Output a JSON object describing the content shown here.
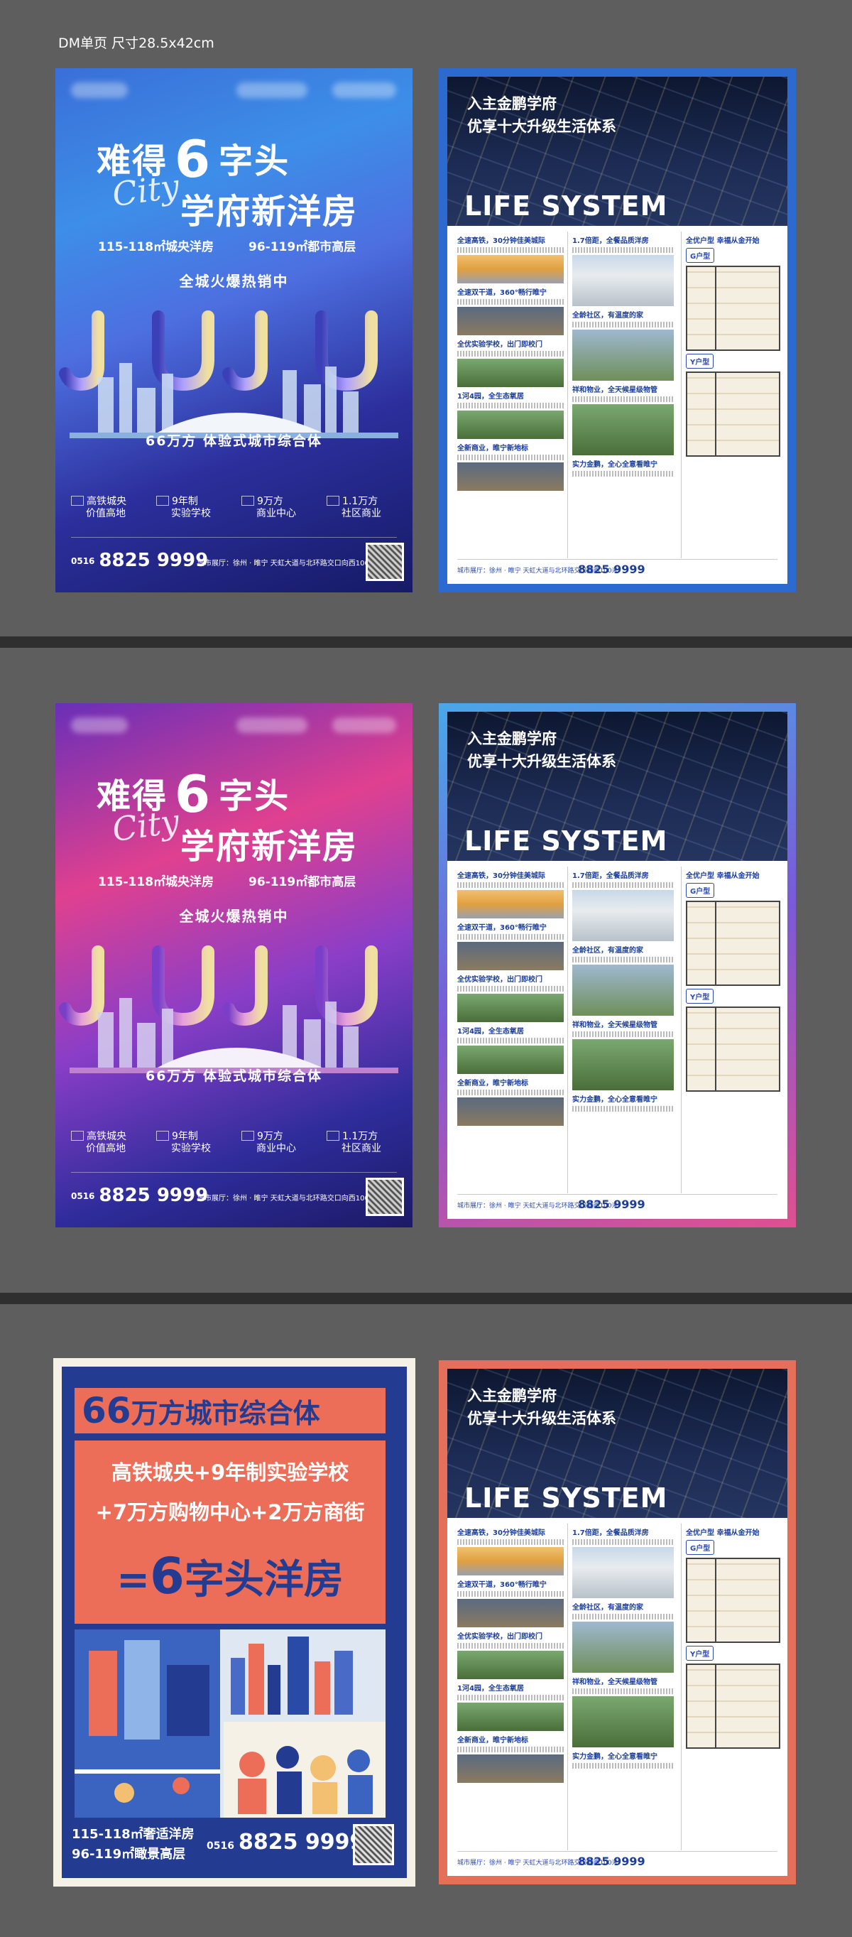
{
  "caption": "DM单页 尺寸28.5x42cm",
  "left_poster": {
    "line1_a": "难得",
    "line1_num": "6",
    "line1_b": "字头",
    "script_word": "City",
    "line2": "学府新洋房",
    "spec_left": "115-118㎡城央洋房",
    "spec_right": "96-119㎡都市高层",
    "hot": "全城火爆热销中",
    "letters": "JIUJIU",
    "slogan": "66万方  体验式城市综合体",
    "features": [
      {
        "l1": "高铁城央",
        "l2": "价值高地"
      },
      {
        "l1": "9年制",
        "l2": "实验学校"
      },
      {
        "l1": "9万方",
        "l2": "商业中心"
      },
      {
        "l1": "1.1万方",
        "l2": "社区商业"
      }
    ],
    "phone_area": "0516",
    "phone": "8825 9999",
    "address": "城市展厅：徐州 · 睢宁  天虹大道与北环路交口向西100米"
  },
  "right_poster": {
    "title1": "入主金鹏学府",
    "title2": "优享十大升级生活体系",
    "life": "LIFE SYSTEM",
    "col1": [
      "全速高铁，30分钟佳美城际",
      "全速双干道，360°畅行睢宁",
      "全优实验学校，出门即校门",
      "1河4园，全生态氧居",
      "全新商业，睢宁新地标"
    ],
    "col2": [
      "1.7倍距，全餐品质洋房",
      "全龄社区，有温度的家",
      "祥和物业，全天候星级物管",
      "实力金鹏，全心全意看睢宁"
    ],
    "col3_head": "全优户型 幸福从金开始",
    "plan_a": "G户型",
    "plan_b": "Y户型",
    "footer_addr": "城市展厅：徐州 · 睢宁 天虹大道与北环路交口向西100米",
    "footer_phone": "8825 9999"
  },
  "poster5": {
    "head_num": "66",
    "head": "万方城市综合体",
    "line1": "高铁城央+9年制实验学校",
    "line2": "+7万方购物中心+2万方商街",
    "eq_a": "=",
    "eq_num": "6",
    "eq_b": "字头洋房",
    "spec1": "115-118㎡奢适洋房",
    "spec2": "96-119㎡瞰景高层",
    "phone_area": "0516",
    "phone": "8825 9999"
  },
  "colors": {
    "blue": "#2c6ad0",
    "coral": "#ec6e58",
    "navy": "#233c92"
  }
}
